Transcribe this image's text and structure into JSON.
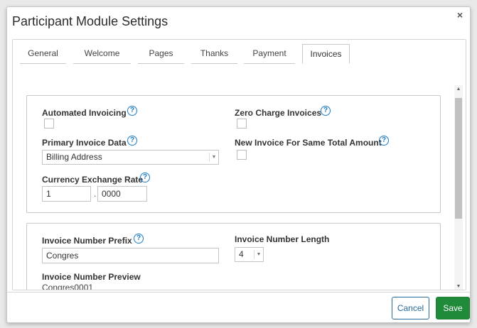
{
  "dialog": {
    "title": "Participant Module Settings",
    "close_label": "×"
  },
  "tabs": [
    {
      "label": "General"
    },
    {
      "label": "Welcome"
    },
    {
      "label": "Pages"
    },
    {
      "label": "Thanks"
    },
    {
      "label": "Payment"
    },
    {
      "label": "Invoices",
      "active": true
    }
  ],
  "help_glyph": "?",
  "invoicing": {
    "automated_invoicing_label": "Automated Invoicing",
    "automated_invoicing_checked": false,
    "zero_charge_label": "Zero Charge Invoices",
    "zero_charge_checked": false,
    "primary_invoice_data_label": "Primary Invoice Data",
    "primary_invoice_data_value": "Billing Address",
    "new_invoice_label": "New Invoice For Same Total Amount",
    "new_invoice_checked": false,
    "currency_rate_label": "Currency Exchange Rate",
    "currency_rate_whole": "1",
    "currency_rate_separator": ".",
    "currency_rate_decimal": "0000"
  },
  "numbering": {
    "prefix_label": "Invoice Number Prefix",
    "prefix_value": "Congres",
    "length_label": "Invoice Number Length",
    "length_value": "4",
    "preview_label": "Invoice Number Preview",
    "preview_value": "Congres0001"
  },
  "scrollbar": {
    "up_arrow": "▲",
    "down_arrow": "▼"
  },
  "dropdown_arrow": "▼",
  "footer": {
    "cancel_label": "Cancel",
    "save_label": "Save"
  },
  "colors": {
    "help_icon": "#1a7bc9",
    "save_button": "#1e8a3a",
    "cancel_border": "#2a6a9a"
  }
}
